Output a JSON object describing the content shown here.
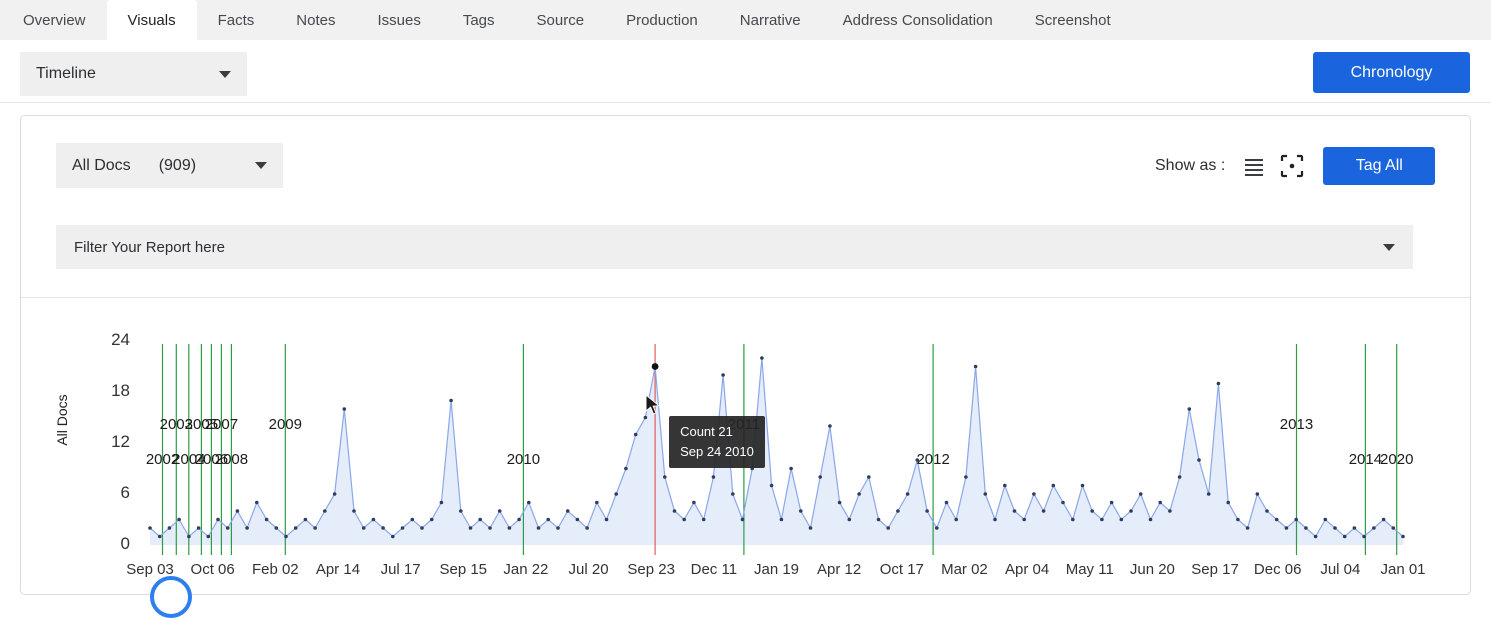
{
  "tabs": {
    "items": [
      "Overview",
      "Visuals",
      "Facts",
      "Notes",
      "Issues",
      "Tags",
      "Source",
      "Production",
      "Narrative",
      "Address Consolidation",
      "Screenshot"
    ],
    "active_index": 1
  },
  "toolbar": {
    "view_select_value": "Timeline",
    "chronology_button": "Chronology"
  },
  "panel": {
    "docs_select_label": "All Docs",
    "docs_select_count": "(909)",
    "show_as_label": "Show as :",
    "tag_all_button": "Tag All",
    "filter_placeholder": "Filter Your Report here"
  },
  "icons": {
    "docs_dropdown": "chevron-down-icon",
    "filter_dropdown": "chevron-down-icon",
    "list_view": "list-view-icon",
    "screenshot_view": "screenshot-view-icon"
  },
  "colors": {
    "primary_blue": "#1a65dd",
    "line": "#8aa7ea",
    "fill": "rgba(138,167,234,0.22)",
    "marker": "#2f3e5c",
    "year_line": "#2e9b45",
    "selected_line": "#e05c5c",
    "tooltip_bg": "rgba(36,36,36,0.92)"
  },
  "chart_data": {
    "type": "line",
    "ylabel": "All Docs",
    "ylim": [
      0,
      24
    ],
    "y_ticks": [
      0,
      6,
      12,
      18,
      24
    ],
    "x_tick_labels": [
      "Sep 03",
      "Oct 06",
      "Feb 02",
      "Apr 14",
      "Jul 17",
      "Sep 15",
      "Jan 22",
      "Jul 20",
      "Sep 23",
      "Dec 11",
      "Jan 19",
      "Apr 12",
      "Oct 17",
      "Mar 02",
      "Apr 04",
      "May 11",
      "Jun 20",
      "Sep 17",
      "Dec 06",
      "Jul 04",
      "Jan 01"
    ],
    "values": [
      2,
      1,
      2,
      3,
      1,
      2,
      1,
      3,
      2,
      4,
      2,
      5,
      3,
      2,
      1,
      2,
      3,
      2,
      4,
      6,
      16,
      4,
      2,
      3,
      2,
      1,
      2,
      3,
      2,
      3,
      5,
      17,
      4,
      2,
      3,
      2,
      4,
      2,
      3,
      5,
      2,
      3,
      2,
      4,
      3,
      2,
      5,
      3,
      6,
      9,
      13,
      15,
      21,
      8,
      4,
      3,
      5,
      3,
      8,
      20,
      6,
      3,
      9,
      22,
      7,
      3,
      9,
      4,
      2,
      8,
      14,
      5,
      3,
      6,
      8,
      3,
      2,
      4,
      6,
      10,
      4,
      2,
      5,
      3,
      8,
      21,
      6,
      3,
      7,
      4,
      3,
      6,
      4,
      7,
      5,
      3,
      7,
      4,
      3,
      5,
      3,
      4,
      6,
      3,
      5,
      4,
      8,
      16,
      10,
      6,
      19,
      5,
      3,
      2,
      6,
      4,
      3,
      2,
      3,
      2,
      1,
      3,
      2,
      1,
      2,
      1,
      2,
      3,
      2,
      1
    ],
    "year_markers": [
      {
        "label": "2002",
        "pos": 0.01,
        "row": 2
      },
      {
        "label": "2003",
        "pos": 0.021,
        "row": 1
      },
      {
        "label": "2004",
        "pos": 0.031,
        "row": 2
      },
      {
        "label": "2005",
        "pos": 0.041,
        "row": 1
      },
      {
        "label": "2006",
        "pos": 0.049,
        "row": 2
      },
      {
        "label": "2007",
        "pos": 0.057,
        "row": 1
      },
      {
        "label": "2008",
        "pos": 0.065,
        "row": 2
      },
      {
        "label": "2009",
        "pos": 0.108,
        "row": 1
      },
      {
        "label": "2010",
        "pos": 0.298,
        "row": 2
      },
      {
        "label": "2011",
        "pos": 0.474,
        "row": 1
      },
      {
        "label": "2012",
        "pos": 0.625,
        "row": 2
      },
      {
        "label": "2013",
        "pos": 0.915,
        "row": 1
      },
      {
        "label": "2014",
        "pos": 0.97,
        "row": 2
      },
      {
        "label": "2020",
        "pos": 0.995,
        "row": 2
      }
    ],
    "selected_index": 52,
    "selected_value": 21,
    "tooltip": {
      "line1": "Count 21",
      "line2": "Sep 24 2010"
    }
  }
}
